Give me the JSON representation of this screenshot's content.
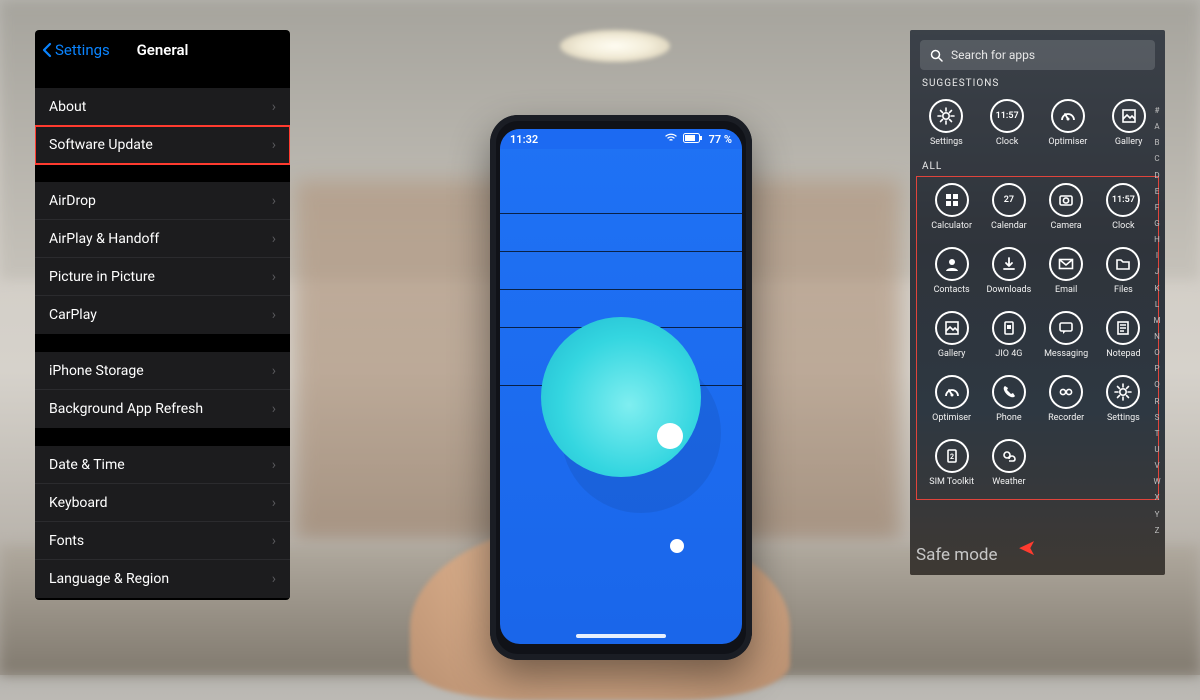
{
  "ios": {
    "back_label": "Settings",
    "title": "General",
    "groups": [
      [
        {
          "label": "About",
          "highlight": false
        },
        {
          "label": "Software Update",
          "highlight": true
        }
      ],
      [
        {
          "label": "AirDrop"
        },
        {
          "label": "AirPlay & Handoff"
        },
        {
          "label": "Picture in Picture"
        },
        {
          "label": "CarPlay"
        }
      ],
      [
        {
          "label": "iPhone Storage"
        },
        {
          "label": "Background App Refresh"
        }
      ],
      [
        {
          "label": "Date & Time"
        },
        {
          "label": "Keyboard"
        },
        {
          "label": "Fonts"
        },
        {
          "label": "Language & Region"
        }
      ]
    ]
  },
  "phone": {
    "status_time": "11:32",
    "status_battery": "77 %",
    "home_indicator": "—"
  },
  "android": {
    "search_placeholder": "Search for apps",
    "section_suggestions": "SUGGESTIONS",
    "section_all": "ALL",
    "suggestions": [
      {
        "label": "Settings",
        "icon": "gear"
      },
      {
        "label": "Clock",
        "icon": "clock",
        "badge": "11:57"
      },
      {
        "label": "Optimiser",
        "icon": "gauge"
      },
      {
        "label": "Gallery",
        "icon": "gallery"
      }
    ],
    "all": [
      {
        "label": "Calculator",
        "icon": "calc"
      },
      {
        "label": "Calendar",
        "icon": "calendar",
        "badge": "27"
      },
      {
        "label": "Camera",
        "icon": "camera"
      },
      {
        "label": "Clock",
        "icon": "clock",
        "badge": "11:57"
      },
      {
        "label": "Contacts",
        "icon": "contact"
      },
      {
        "label": "Downloads",
        "icon": "download"
      },
      {
        "label": "Email",
        "icon": "mail"
      },
      {
        "label": "Files",
        "icon": "folder"
      },
      {
        "label": "Gallery",
        "icon": "gallery"
      },
      {
        "label": "JIO 4G",
        "icon": "sim"
      },
      {
        "label": "Messaging",
        "icon": "chat"
      },
      {
        "label": "Notepad",
        "icon": "note"
      },
      {
        "label": "Optimiser",
        "icon": "gauge"
      },
      {
        "label": "Phone",
        "icon": "phone"
      },
      {
        "label": "Recorder",
        "icon": "recorder"
      },
      {
        "label": "Settings",
        "icon": "gear"
      },
      {
        "label": "SIM Toolkit",
        "icon": "sim2"
      },
      {
        "label": "Weather",
        "icon": "weather"
      }
    ],
    "az_index": [
      "#",
      "A",
      "B",
      "C",
      "D",
      "E",
      "F",
      "G",
      "H",
      "I",
      "J",
      "K",
      "L",
      "M",
      "N",
      "O",
      "P",
      "Q",
      "R",
      "S",
      "T",
      "U",
      "V",
      "W",
      "X",
      "Y",
      "Z"
    ],
    "safe_mode": "Safe mode"
  }
}
